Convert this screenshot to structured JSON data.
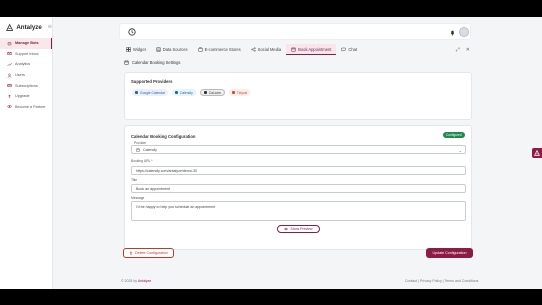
{
  "brand": {
    "name": "Antalyze"
  },
  "sidebar": {
    "items": [
      {
        "label": "Manage Bots",
        "icon": "bot-icon",
        "active": true
      },
      {
        "label": "Support Inbox",
        "icon": "inbox-icon",
        "active": false
      },
      {
        "label": "Analytics",
        "icon": "chart-icon",
        "active": false
      },
      {
        "label": "Users",
        "icon": "users-icon",
        "active": false
      },
      {
        "label": "Subscriptions",
        "icon": "card-icon",
        "active": false
      },
      {
        "label": "Upgrade",
        "icon": "upgrade-icon",
        "active": false
      },
      {
        "label": "Become a Partner",
        "icon": "partner-icon",
        "active": false
      }
    ]
  },
  "tabs": [
    {
      "label": "Widget",
      "icon": "widget-icon",
      "active": false
    },
    {
      "label": "Data Sources",
      "icon": "database-icon",
      "active": false
    },
    {
      "label": "E-commerce Stores",
      "icon": "store-icon",
      "active": false
    },
    {
      "label": "Social Media",
      "icon": "share-icon",
      "active": false
    },
    {
      "label": "Book Appointment",
      "icon": "calendar-icon",
      "active": true
    },
    {
      "label": "Chat",
      "icon": "chat-icon",
      "active": false
    }
  ],
  "section": {
    "title": "Calendar Booking Settings"
  },
  "providers": {
    "title": "Supported Providers",
    "items": [
      {
        "label": "Google Calendar",
        "color": "#2c5fb3"
      },
      {
        "label": "Calendly",
        "color": "#1c6a93"
      },
      {
        "label": "Cal.com",
        "color": "#333333"
      },
      {
        "label": "Tidycal",
        "color": "#c0543b"
      }
    ]
  },
  "config": {
    "title": "Calendar Booking Configuration",
    "status_badge": "Configured",
    "provider_label": "Provider",
    "provider_value": "Calendly",
    "url_label": "Booking URL *",
    "url_value": "https://calendly.com/antalyze/demo-30",
    "title_label": "Title",
    "title_value": "Book an appointment",
    "message_label": "Message",
    "message_value": "I'd be happy to help you schedule an appointment",
    "preview_button": "Show Preview"
  },
  "actions": {
    "delete_label": "Delete Configuration",
    "update_label": "Update Configuration"
  },
  "footer": {
    "copyright": "© 2025",
    "by": "by",
    "brand": "Antalyze",
    "links": "Contact | Privacy Policy | Terms and Conditions"
  },
  "colors": {
    "accent": "#8b1c43",
    "success": "#1f8a4c",
    "danger": "#c0392b"
  }
}
